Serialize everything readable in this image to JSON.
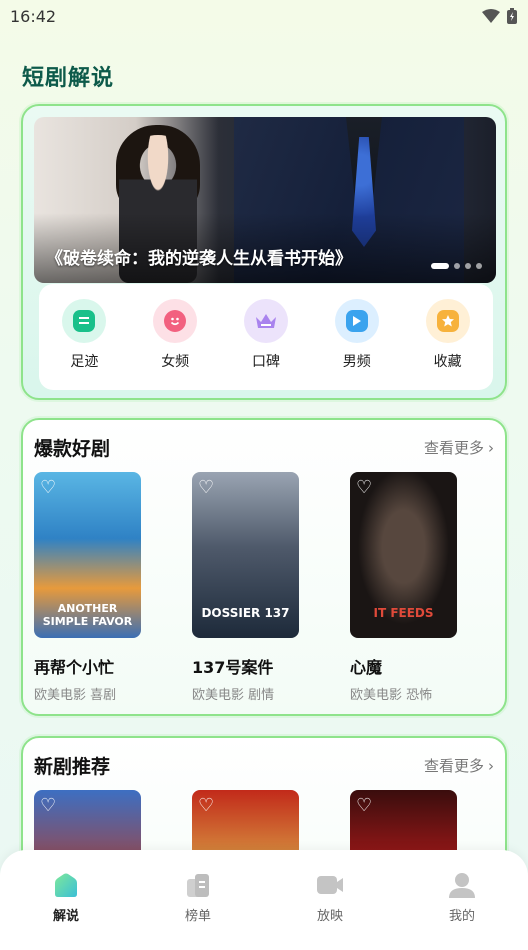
{
  "status_bar": {
    "time": "16:42",
    "wifi_icon": "wifi-icon",
    "battery_icon": "battery-icon"
  },
  "page_title": "短剧解说",
  "banner": {
    "caption": "《破卷续命：我的逆袭人生从看书开始》",
    "page_count": 4,
    "active_index": 0
  },
  "quick_actions": [
    {
      "label": "足迹",
      "icon": "footprint-icon",
      "bg": "#d9f7ec",
      "color": "#19c08a"
    },
    {
      "label": "女频",
      "icon": "smile-icon",
      "bg": "#fde0e6",
      "color": "#f2607f"
    },
    {
      "label": "口碑",
      "icon": "crown-icon",
      "bg": "#ece3fb",
      "color": "#a983ee"
    },
    {
      "label": "男频",
      "icon": "play-icon",
      "bg": "#dcefff",
      "color": "#3aa3ee"
    },
    {
      "label": "收藏",
      "icon": "star-icon",
      "bg": "#fff0d6",
      "color": "#f7b23c"
    }
  ],
  "sections": [
    {
      "title": "爆款好剧",
      "more": "查看更多",
      "items": [
        {
          "title": "再帮个小忙",
          "tags": "欧美电影 喜剧",
          "poster_text": "ANOTHER SIMPLE FAVOR"
        },
        {
          "title": "137号案件",
          "tags": "欧美电影 剧情",
          "poster_text": "DOSSIER 137"
        },
        {
          "title": "心魔",
          "tags": "欧美电影 恐怖",
          "poster_text": "IT FEEDS"
        }
      ]
    },
    {
      "title": "新剧推荐",
      "more": "查看更多",
      "items": [
        {
          "title": "",
          "tags": "",
          "poster_text": ""
        },
        {
          "title": "",
          "tags": "",
          "poster_text": ""
        },
        {
          "title": "",
          "tags": "",
          "poster_text": ""
        }
      ]
    }
  ],
  "bottom_nav": [
    {
      "label": "解说",
      "icon": "home-icon",
      "active": true
    },
    {
      "label": "榜单",
      "icon": "ranking-icon",
      "active": false
    },
    {
      "label": "放映",
      "icon": "video-icon",
      "active": false
    },
    {
      "label": "我的",
      "icon": "user-icon",
      "active": false
    }
  ]
}
